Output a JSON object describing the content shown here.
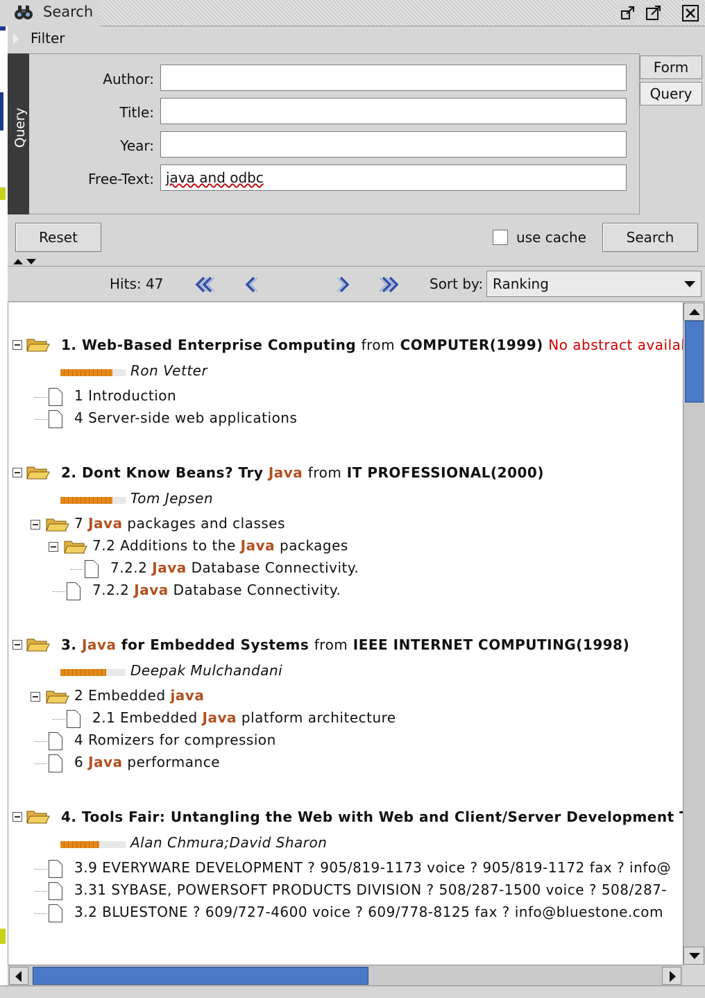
{
  "window": {
    "title": "Search",
    "app_icon": "binoculars-icon",
    "controls": [
      "restore-icon",
      "maximize-icon",
      "close-icon"
    ]
  },
  "filter": {
    "label": "Filter"
  },
  "query_panel": {
    "tab_label": "Query",
    "fields": [
      {
        "label": "Author:",
        "value": ""
      },
      {
        "label": "Title:",
        "value": ""
      },
      {
        "label": "Year:",
        "value": ""
      },
      {
        "label": "Free-Text:",
        "value": "java and odbc"
      }
    ],
    "side_tabs": [
      "Form",
      "Query"
    ]
  },
  "actions": {
    "reset": "Reset",
    "use_cache": "use cache",
    "use_cache_checked": false,
    "search": "Search"
  },
  "nav": {
    "hits": "Hits: 47",
    "sort_label": "Sort by:",
    "sort_value": "Ranking"
  },
  "colors": {
    "keyword": "#b3501f",
    "no_abstract": "#d00000",
    "rank_bar": "#e58a18",
    "scroll_thumb": "#4a79c7"
  },
  "results": [
    {
      "index": "1.",
      "title_parts": [
        {
          "text": "Web-Based Enterprise Computing",
          "kw": false
        }
      ],
      "from": "from",
      "source": "COMPUTER(1999)",
      "note": "No abstract available",
      "rank": 0.8,
      "author": "Ron Vetter",
      "sections": [
        {
          "level": 1,
          "parts": [
            {
              "text": "1 Introduction",
              "kw": false
            }
          ]
        },
        {
          "level": 1,
          "parts": [
            {
              "text": "4 Server-side web applications",
              "kw": false
            }
          ]
        }
      ]
    },
    {
      "index": "2.",
      "title_parts": [
        {
          "text": "Dont Know Beans? Try ",
          "kw": false
        },
        {
          "text": "Java",
          "kw": true
        }
      ],
      "from": "from",
      "source": "IT PROFESSIONAL(2000)",
      "note": "",
      "rank": 0.8,
      "author": "Tom Jepsen",
      "sections": [
        {
          "level": 1,
          "parts": [
            {
              "text": "7 ",
              "kw": false
            },
            {
              "text": "Java",
              "kw": true
            },
            {
              "text": " packages and classes",
              "kw": false
            }
          ]
        },
        {
          "level": 2,
          "parts": [
            {
              "text": "7.2 Additions to the ",
              "kw": false
            },
            {
              "text": "Java",
              "kw": true
            },
            {
              "text": " packages",
              "kw": false
            }
          ]
        },
        {
          "level": 3,
          "parts": [
            {
              "text": "7.2.2 ",
              "kw": false
            },
            {
              "text": "Java",
              "kw": true
            },
            {
              "text": " Database Connectivity.",
              "kw": false
            }
          ]
        },
        {
          "level": 2,
          "parts": [
            {
              "text": "7.2.2 ",
              "kw": false
            },
            {
              "text": "Java",
              "kw": true
            },
            {
              "text": " Database Connectivity.",
              "kw": false
            }
          ]
        }
      ]
    },
    {
      "index": "3.",
      "title_parts": [
        {
          "text": "Java",
          "kw": true
        },
        {
          "text": " for Embedded Systems",
          "kw": false
        }
      ],
      "from": "from",
      "source": "IEEE INTERNET COMPUTING(1998)",
      "note": "",
      "rank": 0.7,
      "author": "Deepak Mulchandani",
      "sections": [
        {
          "level": 1,
          "parts": [
            {
              "text": "2 Embedded ",
              "kw": false
            },
            {
              "text": "java",
              "kw": true
            }
          ]
        },
        {
          "level": 2,
          "parts": [
            {
              "text": "2.1 Embedded ",
              "kw": false
            },
            {
              "text": "Java",
              "kw": true
            },
            {
              "text": " platform architecture",
              "kw": false
            }
          ]
        },
        {
          "level": 1,
          "parts": [
            {
              "text": "4 Romizers for compression",
              "kw": false
            }
          ]
        },
        {
          "level": 1,
          "parts": [
            {
              "text": "6 ",
              "kw": false
            },
            {
              "text": "Java",
              "kw": true
            },
            {
              "text": " performance",
              "kw": false
            }
          ]
        }
      ]
    },
    {
      "index": "4.",
      "title_parts": [
        {
          "text": "Tools Fair: Untangling the Web with Web and Client/Server Development Too",
          "kw": false
        }
      ],
      "from": "",
      "source": "",
      "note": "",
      "rank": 0.6,
      "author": "Alan Chmura;David Sharon",
      "sections": [
        {
          "level": 1,
          "parts": [
            {
              "text": "3.9 EVERYWARE DEVELOPMENT ? 905/819-1173 voice ? 905/819-1172 fax ? info@",
              "kw": false
            }
          ]
        },
        {
          "level": 1,
          "parts": [
            {
              "text": "3.31 SYBASE, POWERSOFT PRODUCTS DIVISION ? 508/287-1500 voice ? 508/287-",
              "kw": false
            }
          ]
        },
        {
          "level": 1,
          "parts": [
            {
              "text": "3.2 BLUESTONE ? 609/727-4600 voice ? 609/778-8125 fax ? info@bluestone.com",
              "kw": false
            }
          ]
        }
      ]
    }
  ]
}
